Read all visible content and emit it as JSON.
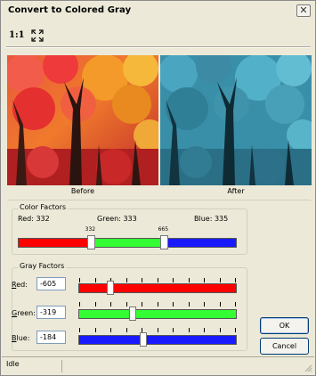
{
  "window": {
    "title": "Convert to Colored Gray",
    "close_glyph": "✕"
  },
  "toolbar": {
    "zoom_label": "1:1",
    "fit_icon": "fit-to-window-icon"
  },
  "images": {
    "before_caption": "Before",
    "after_caption": "After"
  },
  "color_factors": {
    "legend": "Color Factors",
    "red_label": "Red: 332",
    "green_label": "Green: 333",
    "blue_label": "Blue: 335",
    "thumb1_value": "332",
    "thumb2_value": "665",
    "split1": 332,
    "split2": 665,
    "total": 1000,
    "colors": {
      "red": "#ff0000",
      "green": "#33ff33",
      "blue": "#1a1aff"
    }
  },
  "gray_factors": {
    "legend": "Gray Factors",
    "rows": [
      {
        "key_letter": "R",
        "label_rest": "ed:",
        "value": "-605",
        "color": "#ff0000",
        "position": 0.2
      },
      {
        "key_letter": "G",
        "label_rest": "reen:",
        "value": "-319",
        "color": "#33ff33",
        "position": 0.34
      },
      {
        "key_letter": "B",
        "label_rest": "lue:",
        "value": "-184",
        "color": "#1a1aff",
        "position": 0.41
      }
    ]
  },
  "buttons": {
    "ok": "OK",
    "cancel": "Cancel"
  },
  "status": {
    "text": "Idle"
  }
}
